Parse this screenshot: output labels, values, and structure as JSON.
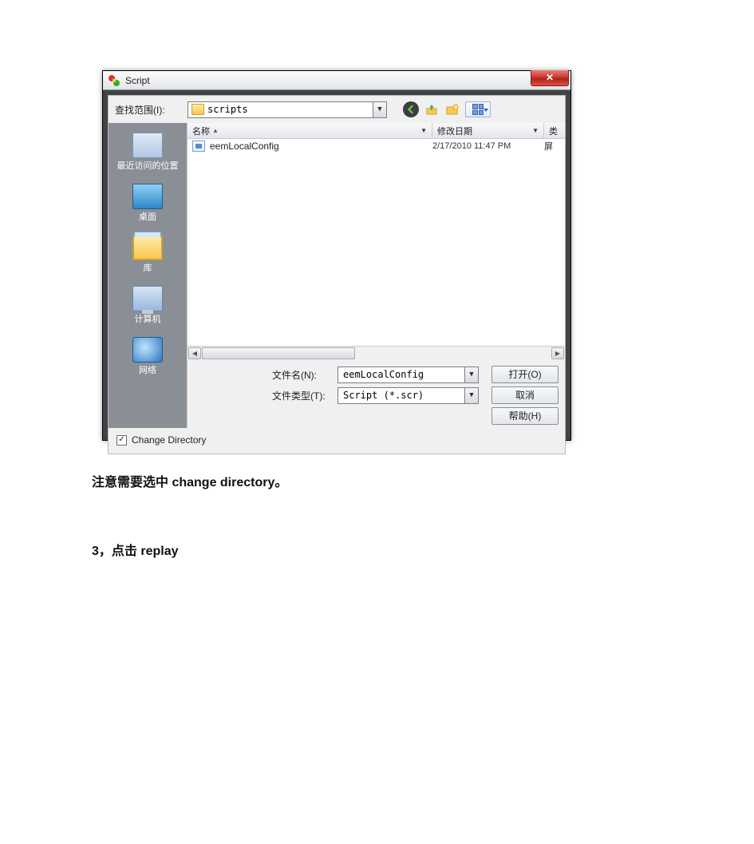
{
  "dialog": {
    "title": "Script",
    "close_glyph": "✕",
    "lookin_label": "查找范围(I):",
    "lookin_value": "scripts",
    "columns": {
      "name": "名称",
      "date": "修改日期",
      "type": "类"
    },
    "files": [
      {
        "name": "eemLocalConfig",
        "date": "2/17/2010 11:47 PM",
        "type": "屏"
      }
    ],
    "filename_label": "文件名(N):",
    "filename_value": "eemLocalConfig",
    "filetype_label": "文件类型(T):",
    "filetype_value": "Script (*.scr)",
    "buttons": {
      "open": "打开(O)",
      "cancel": "取消",
      "help": "帮助(H)"
    },
    "change_dir_label": "Change Directory",
    "change_dir_checked": "✓",
    "places": {
      "recent": "最近访问的位置",
      "desktop": "桌面",
      "library": "库",
      "computer": "计算机",
      "network": "网络"
    },
    "toolbar_icons": {
      "back": "⬅",
      "up": "⬆",
      "newfolder": "📁"
    }
  },
  "doc": {
    "note": "注意需要选中 change  directory。",
    "step3": "3，点击 replay"
  }
}
